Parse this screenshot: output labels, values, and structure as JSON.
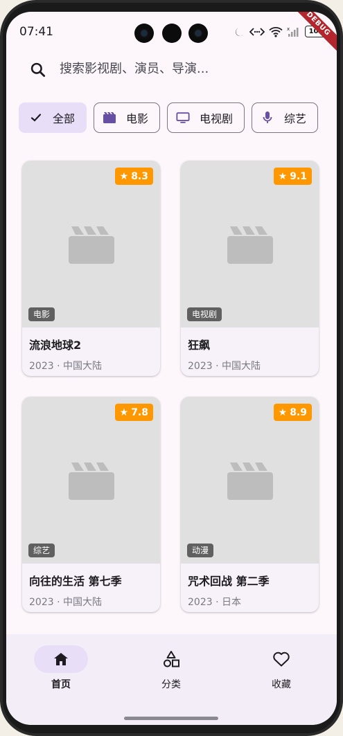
{
  "status_bar": {
    "time": "07:41",
    "battery": "100",
    "debug_banner": "DEBUG"
  },
  "search": {
    "placeholder": "搜索影视剧、演员、导演..."
  },
  "filter_chips": [
    {
      "label": "全部",
      "icon": "check-icon",
      "selected": true
    },
    {
      "label": "电影",
      "icon": "movie-icon",
      "selected": false
    },
    {
      "label": "电视剧",
      "icon": "tv-icon",
      "selected": false
    },
    {
      "label": "综艺",
      "icon": "mic-icon",
      "selected": false
    }
  ],
  "cards": [
    {
      "title": "流浪地球2",
      "rating": "8.3",
      "type": "电影",
      "year": "2023",
      "region": "中国大陆"
    },
    {
      "title": "狂飙",
      "rating": "9.1",
      "type": "电视剧",
      "year": "2023",
      "region": "中国大陆"
    },
    {
      "title": "向往的生活 第七季",
      "rating": "7.8",
      "type": "综艺",
      "year": "2023",
      "region": "中国大陆"
    },
    {
      "title": "咒术回战 第二季",
      "rating": "8.9",
      "type": "动漫",
      "year": "2023",
      "region": "日本"
    }
  ],
  "meta_separator": "·",
  "bottom_nav": [
    {
      "label": "首页",
      "icon": "home-icon",
      "active": true
    },
    {
      "label": "分类",
      "icon": "category-icon",
      "active": false
    },
    {
      "label": "收藏",
      "icon": "heart-icon",
      "active": false
    }
  ],
  "colors": {
    "rating_badge": "#ff9800",
    "selected_chip": "#e8def8",
    "primary": "#6750a4"
  }
}
